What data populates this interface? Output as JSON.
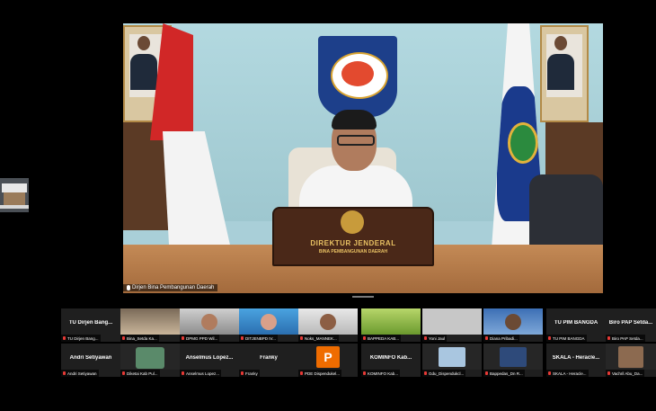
{
  "main_video": {
    "participant_name": "Dirjen Bina Pembangunan Daerah",
    "nameplate_line1": "DIREKTUR JENDERAL",
    "nameplate_line2": "BINA PEMBANGUNAN DAERAH"
  },
  "participants": [
    {
      "title": "TU Dirjen Bang...",
      "label": "TU Dirjen Bang..."
    },
    {
      "title": "",
      "label": "Bina_Setda Ka..."
    },
    {
      "title": "",
      "label": "DPMG PPD Wil..."
    },
    {
      "title": "",
      "label": "DITJENBPD IV..."
    },
    {
      "title": "",
      "label": "Noks_MANNEK..."
    },
    {
      "title": "",
      "label": "BAPPEDA KAB..."
    },
    {
      "title": "",
      "label": "Yoni Jaul"
    },
    {
      "title": "",
      "label": "Diana Pribadi..."
    },
    {
      "title": "TU PIM BANGDA",
      "label": "TU PIM BANGDA"
    },
    {
      "title": "Biro PAP Setda...",
      "label": "Biro PAP Setda..."
    },
    {
      "title": "Andri Setiyawan",
      "label": "Andri Setiyawan"
    },
    {
      "title": "",
      "label": "Diketai Kab Pul..."
    },
    {
      "title": "Anselmus Lopez...",
      "label": "Anselmus Lopez..."
    },
    {
      "title": "Franky",
      "label": "Franky"
    },
    {
      "title": "",
      "label": "PDE Dispendukel...",
      "avatar": "P"
    },
    {
      "title": "KOMINFO Kab...",
      "label": "KOMINFO Kab..."
    },
    {
      "title": "",
      "label": "Gdu_Dispendukcl..."
    },
    {
      "title": "",
      "label": "Bappedas_Dn R..."
    },
    {
      "title": "SKALA - Heracle...",
      "label": "SKALA - Heracle..."
    },
    {
      "title": "",
      "label": "Vachril Abu_Da..."
    }
  ],
  "colors": {
    "background": "#000000",
    "tile_background": "#1f1f1f",
    "mute_icon": "#e53935",
    "avatar_orange": "#ef6c00"
  }
}
